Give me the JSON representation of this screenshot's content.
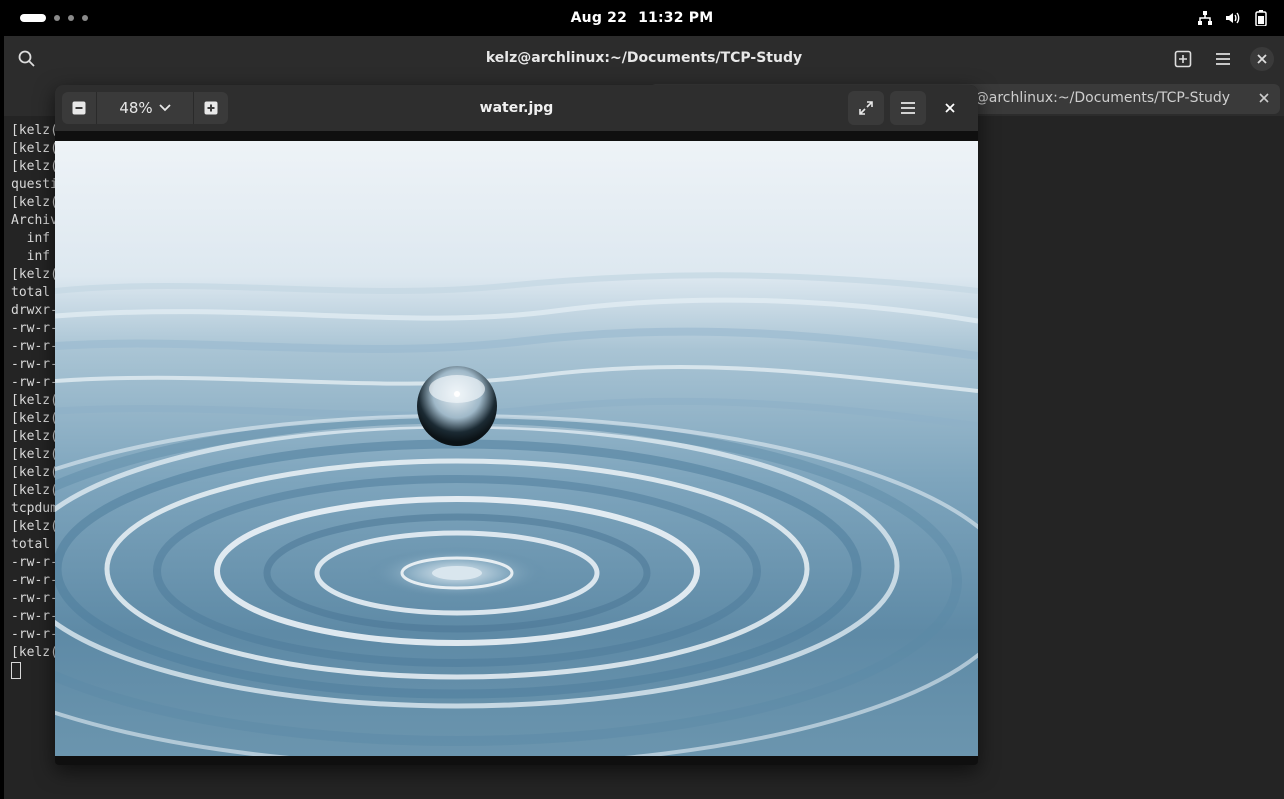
{
  "topbar": {
    "date": "Aug 22",
    "time": "11:32 PM",
    "icons": [
      "network-icon",
      "volume-icon",
      "battery-icon"
    ]
  },
  "terminal": {
    "title": "kelz@archlinux:~/Documents/TCP-Study",
    "tab_label": "kelz@archlinux:~/Documents/TCP-Study",
    "lines": [
      "[kelz(",
      "[kelz(",
      "[kelz(",
      "questi",
      "[kelz(",
      "Archiv",
      "  inf",
      "  inf",
      "[kelz(",
      "total",
      "drwxr-",
      "-rw-r-",
      "-rw-r-",
      "-rw-r-",
      "-rw-r-",
      "[kelz(",
      "[kelz(",
      "[kelz(",
      "[kelz(",
      "[kelz(",
      "[kelz(",
      "tcpdum",
      "[kelz(",
      "total",
      "-rw-r-",
      "-rw-r-",
      "-rw-r-",
      "-rw-r-",
      "-rw-r-",
      "[kelz("
    ]
  },
  "viewer": {
    "title": "water.jpg",
    "zoom": "48%",
    "colors": {
      "header": "#2e2e2e",
      "button": "#3a3a3a"
    }
  }
}
